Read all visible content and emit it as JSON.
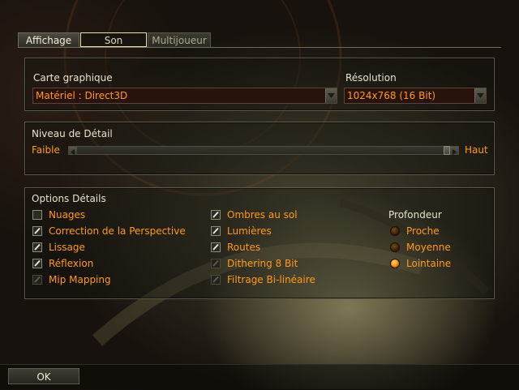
{
  "tabs": [
    {
      "label": "Affichage",
      "active": true
    },
    {
      "label": "Son",
      "active": false
    },
    {
      "label": "Multijoueur",
      "active": false
    }
  ],
  "graphics": {
    "card_label": "Carte graphique",
    "card_value": "Matériel : Direct3D",
    "resolution_label": "Résolution",
    "resolution_value": "1024x768 (16 Bit)"
  },
  "detail_level": {
    "title": "Niveau de Détail",
    "low_label": "Faible",
    "high_label": "Haut",
    "level": 1.0
  },
  "options": {
    "title": "Options Détails",
    "col1": [
      {
        "label": "Nuages",
        "checked": false,
        "enabled": true
      },
      {
        "label": "Correction de la Perspective",
        "checked": true,
        "enabled": true
      },
      {
        "label": "Lissage",
        "checked": true,
        "enabled": true
      },
      {
        "label": "Réflexion",
        "checked": true,
        "enabled": true
      },
      {
        "label": "Mip Mapping",
        "checked": true,
        "enabled": false
      }
    ],
    "col2": [
      {
        "label": "Ombres au sol",
        "checked": true,
        "enabled": true
      },
      {
        "label": "Lumières",
        "checked": true,
        "enabled": true
      },
      {
        "label": "Routes",
        "checked": true,
        "enabled": true
      },
      {
        "label": "Dithering 8 Bit",
        "checked": true,
        "enabled": false
      },
      {
        "label": "Filtrage Bi-linéaire",
        "checked": true,
        "enabled": false
      }
    ],
    "depth": {
      "title": "Profondeur",
      "choices": [
        "Proche",
        "Moyenne",
        "Lointaine"
      ],
      "selected": "Lointaine"
    }
  },
  "footer": {
    "ok_label": "OK"
  },
  "colors": {
    "accent": "#ff9a1a",
    "label": "#e6e3cf"
  }
}
